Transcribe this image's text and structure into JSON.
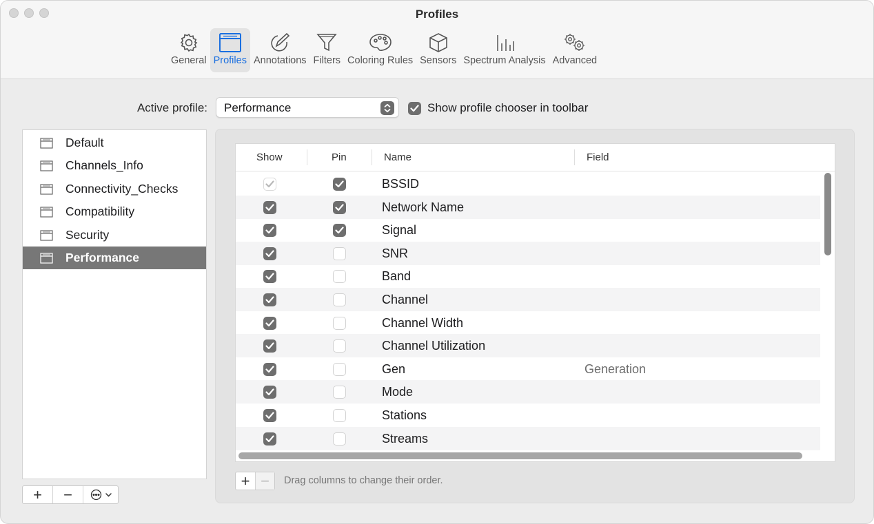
{
  "window": {
    "title": "Profiles"
  },
  "toolbar": {
    "tabs": [
      {
        "label": "General",
        "icon": "gear-icon"
      },
      {
        "label": "Profiles",
        "icon": "window-icon",
        "active": true
      },
      {
        "label": "Annotations",
        "icon": "annotation-icon"
      },
      {
        "label": "Filters",
        "icon": "funnel-icon"
      },
      {
        "label": "Coloring Rules",
        "icon": "palette-icon"
      },
      {
        "label": "Sensors",
        "icon": "cube-icon"
      },
      {
        "label": "Spectrum Analysis",
        "icon": "spectrum-icon"
      },
      {
        "label": "Advanced",
        "icon": "gears-icon"
      }
    ]
  },
  "active_profile": {
    "label": "Active profile:",
    "value": "Performance",
    "chooser_label": "Show profile chooser in toolbar",
    "chooser_checked": true
  },
  "sidebar": {
    "items": [
      {
        "label": "Default"
      },
      {
        "label": "Channels_Info"
      },
      {
        "label": "Connectivity_Checks"
      },
      {
        "label": "Compatibility"
      },
      {
        "label": "Security"
      },
      {
        "label": "Performance",
        "selected": true
      }
    ],
    "buttons": {
      "add": "+",
      "remove": "−"
    }
  },
  "table": {
    "headers": {
      "show": "Show",
      "pin": "Pin",
      "name": "Name",
      "field": "Field"
    },
    "rows": [
      {
        "name": "BSSID",
        "field": "",
        "show": "disabled",
        "pin": true
      },
      {
        "name": "Network Name",
        "field": "",
        "show": true,
        "pin": true
      },
      {
        "name": "Signal",
        "field": "",
        "show": true,
        "pin": true
      },
      {
        "name": "SNR",
        "field": "",
        "show": true,
        "pin": false
      },
      {
        "name": "Band",
        "field": "",
        "show": true,
        "pin": false
      },
      {
        "name": "Channel",
        "field": "",
        "show": true,
        "pin": false
      },
      {
        "name": "Channel Width",
        "field": "",
        "show": true,
        "pin": false
      },
      {
        "name": "Channel Utilization",
        "field": "",
        "show": true,
        "pin": false
      },
      {
        "name": "Gen",
        "field": "Generation",
        "show": true,
        "pin": false
      },
      {
        "name": "Mode",
        "field": "",
        "show": true,
        "pin": false
      },
      {
        "name": "Stations",
        "field": "",
        "show": true,
        "pin": false
      },
      {
        "name": "Streams",
        "field": "",
        "show": true,
        "pin": false
      }
    ],
    "add_label": "+",
    "remove_label": "−",
    "hint": "Drag columns to change their order."
  },
  "colors": {
    "accent": "#1a6fe0",
    "selection": "#777777",
    "checkbox": "#6e6e6e"
  }
}
